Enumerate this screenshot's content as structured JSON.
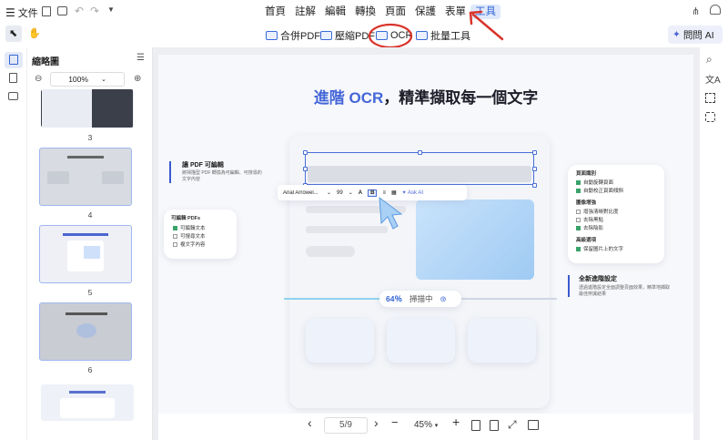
{
  "file_menu": {
    "label": "文件"
  },
  "tabs": [
    "首頁",
    "註解",
    "編輯",
    "轉換",
    "頁面",
    "保護",
    "表單",
    "工具"
  ],
  "active_tab": "工具",
  "tools": {
    "merge_pdf": "合併PDF",
    "compress_pdf": "壓縮PDF",
    "ocr": "OCR",
    "batch": "批量工具"
  },
  "ask_ai": "問問 AI",
  "thumbnails": {
    "title": "縮略圖",
    "zoom": "100%",
    "pages": [
      "3",
      "4",
      "5",
      "6"
    ]
  },
  "doc": {
    "headline_accent": "進階 OCR",
    "headline_rest": "，精準擷取每一個文字",
    "left_block_title": "讓 PDF 可編輯",
    "left_block_text": "將掃描型 PDF 轉換為可編輯、可搜尋的文字內容",
    "left_card_title": "可編輯 PDFs",
    "left_card_items": [
      "可編輯文本",
      "可搜尋文本",
      "複文字內容"
    ],
    "right_card_title": "頁面識別",
    "right_card_group1": [
      "自動旋轉頁面",
      "自動校正頁面傾斜"
    ],
    "right_card_group2_title": "圖像增強",
    "right_card_group2": [
      "增強清晰對比度",
      "去除黑點",
      "去除陰影"
    ],
    "right_card_group3_title": "高級選項",
    "right_card_group3": [
      "保留圖片上的文字"
    ],
    "right_block_title": "全新進階設定",
    "right_block_text": "透過進階設定全面調整頁面效果，精準地擷取最佳辨識結果",
    "format_toolbar": {
      "font": "Arial Arrowel...",
      "size": "99",
      "ask_ai": "Ask AI"
    },
    "progress": {
      "percent": "64％",
      "label": "掃描中",
      "value": 0.64
    }
  },
  "bottom": {
    "page_indicator": "5/9",
    "zoom": "45%"
  },
  "colors": {
    "accent": "#3566d6",
    "annotation_red": "#d9342b",
    "page_bg": "#eceef1"
  }
}
